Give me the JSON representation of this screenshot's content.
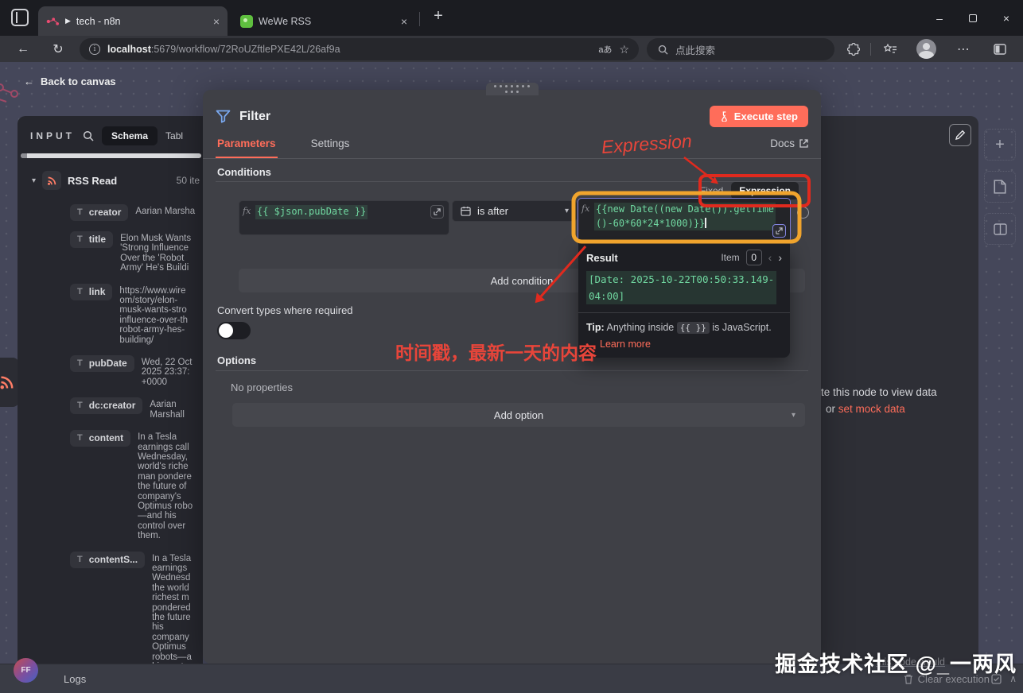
{
  "colors": {
    "accent_orange": "#ff6d5a",
    "code_green": "#70d7a0",
    "annotation_red": "#e8453a",
    "highlight_gold": "#f0a42d"
  },
  "browser": {
    "tabs": [
      {
        "title": "tech - n8n"
      },
      {
        "title": "WeWe RSS"
      }
    ],
    "url_host": "localhost",
    "url_rest": ":5679/workflow/72RoUZftlePXE42L/26af9a",
    "lang_badge": "aあ",
    "search_placeholder": "点此搜索"
  },
  "canvas": {
    "back_label": "Back to canvas",
    "plus_tool": "+"
  },
  "input_panel": {
    "title": "INPUT",
    "tab_schema": "Schema",
    "tab_table": "Tabl",
    "node_name": "RSS Read",
    "node_count": "50 ite",
    "fields": [
      {
        "key": "creator",
        "value": "Aarian Marsha"
      },
      {
        "key": "title",
        "value": "Elon Musk Wants\n'Strong Influence\nOver the 'Robot\nArmy' He's Buildi"
      },
      {
        "key": "link",
        "value": "https://www.wire\nom/story/elon-\nmusk-wants-stro\ninfluence-over-th\nrobot-army-hes-\nbuilding/"
      },
      {
        "key": "pubDate",
        "value": "Wed, 22 Oct\n2025 23:37:\n+0000"
      },
      {
        "key": "dc:creator",
        "value": "Aarian\nMarshall"
      },
      {
        "key": "content",
        "value": "In a Tesla\nearnings call\nWednesday,\nworld's riche\nman pondere\nthe future of\ncompany's\nOptimus robo\n—and his\ncontrol over\nthem."
      },
      {
        "key": "contentS...",
        "value": "In a Tesla\nearnings\nWednesd\nthe world\nrichest m\npondered\nthe future\nhis\ncompany\nOptimus\nrobots—a\nhis contr"
      }
    ]
  },
  "dialog": {
    "title": "Filter",
    "execute_label": "Execute step",
    "tab_parameters": "Parameters",
    "tab_settings": "Settings",
    "docs_label": "Docs",
    "conditions_heading": "Conditions",
    "toggle_fixed": "Fixed",
    "toggle_expression": "Expression",
    "left_expression": "{{ $json.pubDate }}",
    "operator": "is after",
    "right_expression": "{{new Date((new Date()).getTime\n()-60*60*24*1000)}}",
    "add_condition_label": "Add condition",
    "convert_label": "Convert types where required",
    "options_heading": "Options",
    "no_properties": "No properties",
    "add_option_label": "Add option",
    "result": {
      "title": "Result",
      "item_label": "Item",
      "item_value": "0",
      "prev": "‹",
      "next": "›",
      "value": "[Date: 2025-10-22T00:50:33.149-\n04:00]",
      "tip_label": "Tip:",
      "tip_before": "Anything inside",
      "tip_code": "{{ }}",
      "tip_after": "is JavaScript.",
      "learn_more": "Learn more"
    }
  },
  "output_panel": {
    "hint_line": "te this node to view data",
    "hint_or": "or ",
    "mock_link": "set mock data"
  },
  "footer": {
    "logs_label": "Logs",
    "avatar_initials": "FF",
    "clear_execution": "Clear execution",
    "faint_fragment": "this node would",
    "watermark": "掘金技术社区 @_一两风"
  },
  "annotations": {
    "expression_label": "Expression",
    "timestamp_note": "时间戳，最新一天的内容"
  }
}
